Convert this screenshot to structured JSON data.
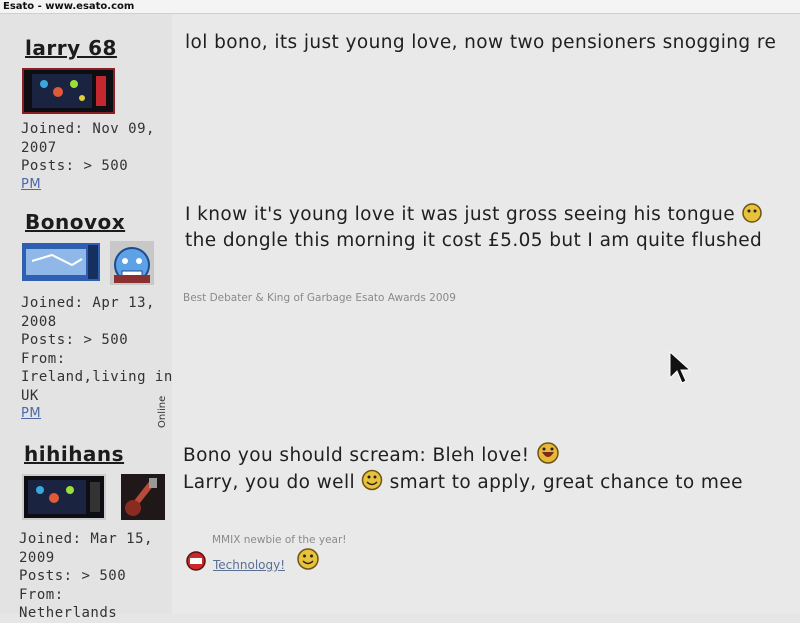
{
  "window": {
    "title": "Esato - www.esato.com"
  },
  "posts": [
    {
      "username": "larry 68",
      "joined": "Joined: Nov 09,",
      "joined_year": "2007",
      "posts": "Posts: > 500",
      "pm": "PM",
      "text_lines": [
        "lol bono, its just young love, now two pensioners snogging re"
      ]
    },
    {
      "username": "Bonovox",
      "joined": "Joined: Apr 13,",
      "joined_year": "2008",
      "posts": "Posts: > 500",
      "from_label": "From:",
      "from_line1": "Ireland,living in",
      "from_line2": "UK",
      "pm": "PM",
      "online": "Online",
      "text_lines": [
        "I know it's young love it was just gross seeing his tongue",
        "the dongle this morning it cost £5.05 but I am quite flushed"
      ],
      "signature": "Best Debater & King of Garbage Esato Awards 2009"
    },
    {
      "username": "hihihans",
      "joined": "Joined: Mar 15,",
      "joined_year": "2009",
      "posts": "Posts: > 500",
      "from_label": "From:",
      "from_line1": "Netherlands",
      "text_line1": "Bono you should scream: Bleh love!",
      "text_line2_a": "Larry, you do well",
      "text_line2_b": "smart to apply, great chance to mee",
      "signature": "MMIX newbie of the year!",
      "sig_link": "Technology!"
    }
  ]
}
